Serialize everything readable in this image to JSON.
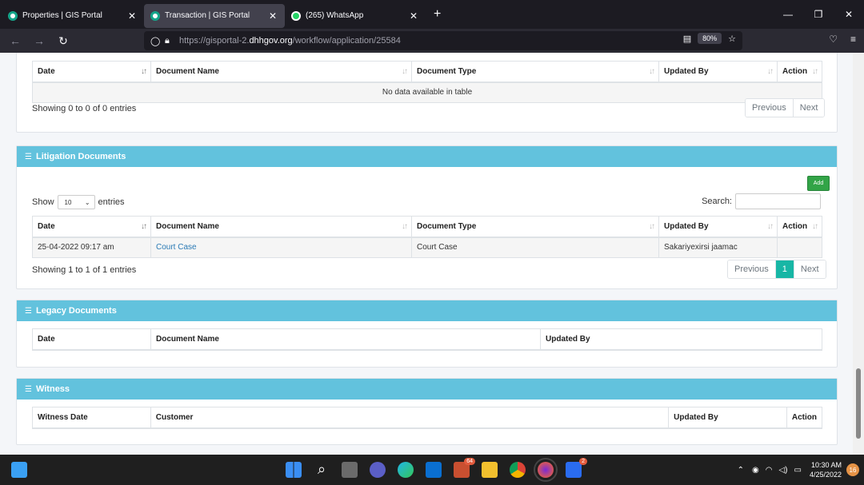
{
  "browser": {
    "tabs": [
      {
        "title": "Properties | GIS Portal",
        "active": false
      },
      {
        "title": "Transaction | GIS Portal",
        "active": true
      },
      {
        "title": "(265) WhatsApp",
        "active": false
      }
    ],
    "url_prefix": "https://gisportal-2.",
    "url_host": "dhhgov.org",
    "url_path": "/workflow/application/25584",
    "zoom": "80%"
  },
  "documents_section": {
    "columns": [
      "Date",
      "Document Name",
      "Document Type",
      "Updated By",
      "Action"
    ],
    "empty_text": "No data available in table",
    "info": "Showing 0 to 0 of 0 entries",
    "prev_label": "Previous",
    "next_label": "Next"
  },
  "litigation": {
    "title": "Litigation Documents",
    "add_label": "Add",
    "show_label": "Show",
    "entries_label": "entries",
    "page_length": "10",
    "search_label": "Search:",
    "columns": [
      "Date",
      "Document Name",
      "Document Type",
      "Updated By",
      "Action"
    ],
    "rows": [
      {
        "date": "25-04-2022 09:17 am",
        "document_name": "Court Case",
        "document_type": "Court Case",
        "updated_by": "Sakariyexirsi jaamac",
        "action": ""
      }
    ],
    "info": "Showing 1 to 1 of 1 entries",
    "prev_label": "Previous",
    "current_page": "1",
    "next_label": "Next"
  },
  "legacy": {
    "title": "Legacy Documents",
    "columns": [
      "Date",
      "Document Name",
      "Updated By"
    ]
  },
  "witness": {
    "title": "Witness",
    "columns": [
      "Witness Date",
      "Customer",
      "Updated By",
      "Action"
    ]
  },
  "taskbar": {
    "badge_a": "64",
    "badge_b": "2",
    "time": "10:30 AM",
    "date": "4/25/2022",
    "notifications": "16"
  }
}
